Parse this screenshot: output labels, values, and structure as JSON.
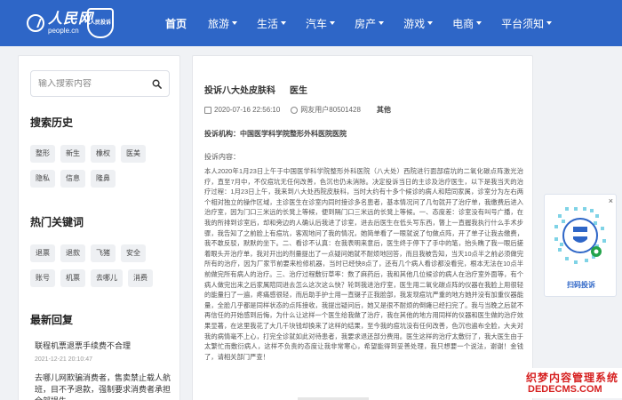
{
  "header": {
    "logo_text": "人民网",
    "logo_sub": "people.cn",
    "badge_text": "人民投诉",
    "nav": [
      {
        "label": "首页",
        "active": true
      },
      {
        "label": "旅游",
        "has_caret": true
      },
      {
        "label": "生活",
        "has_caret": true
      },
      {
        "label": "汽车",
        "has_caret": true
      },
      {
        "label": "房产",
        "has_caret": true
      },
      {
        "label": "游戏",
        "has_caret": true
      },
      {
        "label": "电商",
        "has_caret": true
      },
      {
        "label": "平台须知",
        "has_caret": true
      }
    ],
    "color": "#2e66c7"
  },
  "sidebar": {
    "search_placeholder": "输入搜索内容",
    "history_title": "搜索历史",
    "history_tags": [
      "整形",
      "新生",
      "橡权",
      "医美",
      "隐私",
      "信息",
      "隆鼻"
    ],
    "hot_title": "热门关键词",
    "hot_tags": [
      "退票",
      "退款",
      "飞猪",
      "安全",
      "账号",
      "机票",
      "去哪儿",
      "消费"
    ],
    "recent_title": "最新回复",
    "recent": [
      {
        "title": "联程机票退票手续费不合理",
        "time": "2021-12-21 20:10:47"
      },
      {
        "title": "去哪儿网欺骗消费者，售卖禁止载人航班，目不予退款，强制要求消费者承担全部损失"
      }
    ]
  },
  "complaint": {
    "prefix": "投诉八大处皮肤科",
    "target": "医生",
    "date": "2020-07-16 22:56:10",
    "user": "网友用户80501428",
    "category": "其他",
    "institution_label": "投诉机构：",
    "institution": "中国医学科学院整形外科医院医院",
    "content_label": "投诉内容：",
    "content": "本人2020年1月23日上午于中国医学科学院整形外科医院（八大处）西院进行面部痘坑的二氧化碳点阵激光治疗，直至7月中，不仅痘坑无任何改善，色沉也仍未消除。决定投诉当日的主诊及治疗医生，以下是我当天的治疗过程：1月23日上午，我来到八大处西院皮肤科，当时大约有十多个候诊的病人和陪同家属，诊室分为左右两个相对独立的操作区域，主诊医生在诊室内同时接诊多名患者，基本情况问了几句就开了治疗单，我缴费后进入治疗室，因为门口三米远的长凳上等候，便到隔门口三米远的长凳上等候。一、态度差：诊室没有叫号广播，在我的所排到诊室后，却和旁边的人确认后我进了诊室，进去后医生在低头写东西，瞥上一直握我执行什么手术步骤，我告知了之前脸上有痘坑，客观地问了我的情况，她简单看了一眼就说了句做点阵，开了单子让我去缴费，我不敢反驳，默默的坐下。二、看诊不认真：在我表明来意后，医生终于停下了手中的笔，抬头瞧了我一眼后搓着眼头开治疗单，我对开出的剂量提出了一点疑问她就不耐烦地回答，而且我被告知，当天10点半之前必须做完所有的治疗，因为厂家节前要来检修机器，当时已经快8点了，还有几个病人看诊都没看完，根本无法在10点半前做完所有病人的治疗。三、治疗过程敷衍草率：数了麻药后，我和其他几位候诊的病人在治疗室外面等，有个病人做完出来之后家属陪同进去怎么这次这么快？轮到我进治疗室，医生用二氧化碳点阵的仪器在我脸上用很轻的能量扫了一遍，疼痛感很轻，而后助手护士用一直镊子正我脸部，我发现痘坑严重的地方她并没有加重仪器能量，全脸几乎都是同样状态的点阵接收，我提出疑问后，她又是很不耐烦的倒瘫已经扫完了。我与当晚之后就不再信任的开始感到后悔，为什么让这样一个医生给我做了治疗，我在其他的地方用同样的仪器和医生做的治疗效果显著，在这里我花了大几千块钱却换来了这样的结果，至今我的痘坑没有任何改善，色沉也遍布全脸，大夫对我的病情毫不上心，打完全诊就如此对待患者，我要求退还部分费用。",
    "content_end": "医生这样的治疗太敷衍了，我大医生由于太繁忙而敷衍病人，这样不负责的态度让我非常寒心，希望能得到妥善处理，我只想要一个说法，谢谢！",
    "closing": "金钱了，请相关部门严查！"
  },
  "qr_widget": {
    "close_label": "×",
    "label": "扫码投诉"
  },
  "watermark": {
    "line1": "织梦内容管理系统",
    "line2": "DEDECMS.COM"
  }
}
